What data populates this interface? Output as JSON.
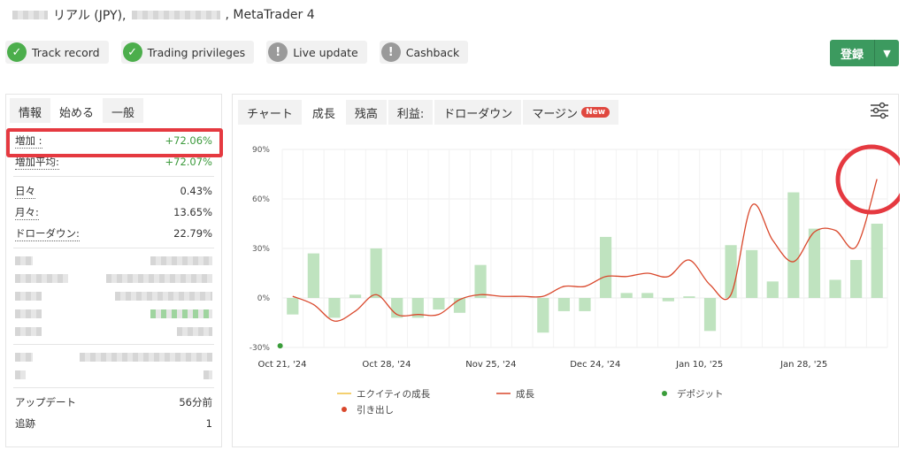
{
  "header": {
    "account_type": "リアル (JPY),",
    "platform": ", MetaTrader 4"
  },
  "badges": [
    {
      "label": "Track record",
      "status": "ok"
    },
    {
      "label": "Trading privileges",
      "status": "ok"
    },
    {
      "label": "Live update",
      "status": "warn"
    },
    {
      "label": "Cashback",
      "status": "warn"
    }
  ],
  "register": {
    "label": "登録",
    "dropdown_icon": "chevron-down-icon"
  },
  "left_tabs": [
    "情報",
    "始める",
    "一般"
  ],
  "stats_top": [
    {
      "label": "増加 :",
      "value": "+72.06%"
    },
    {
      "label": "増加平均:",
      "value": "+72.07%"
    }
  ],
  "stats_mid": [
    {
      "label": "日々",
      "value": "0.43%"
    },
    {
      "label": "月々:",
      "value": "13.65%"
    },
    {
      "label": "ドローダウン:",
      "value": "22.79%"
    }
  ],
  "stats_bottom": [
    {
      "label": "アップデート",
      "value": "56分前"
    },
    {
      "label": "追跡",
      "value": "1"
    }
  ],
  "chart_tabs": [
    {
      "label": "チャート",
      "active": false
    },
    {
      "label": "成長",
      "active": true
    },
    {
      "label": "残高",
      "active": false
    },
    {
      "label": "利益:",
      "active": false
    },
    {
      "label": "ドローダウン",
      "active": false
    },
    {
      "label": "マージン",
      "active": false,
      "badge": "New"
    }
  ],
  "chart_data": {
    "type": "bar",
    "y_ticks": [
      "90%",
      "60%",
      "30%",
      "0%",
      "-30%"
    ],
    "ylim": [
      -30,
      90
    ],
    "x_tick_labels": [
      "Oct 21, '24",
      "Oct 28, '24",
      "Nov 25, '24",
      "Dec 24, '24",
      "Jan 10, '25",
      "Jan 28, '25"
    ],
    "x_tick_index": [
      0,
      5,
      10,
      15,
      20,
      25
    ],
    "bars": [
      -10,
      27,
      -12,
      2,
      30,
      -12,
      -12,
      -7,
      -9,
      20,
      0,
      0,
      -21,
      -8,
      -8,
      37,
      3,
      3,
      -2,
      1,
      -20,
      32,
      29,
      10,
      64,
      42,
      11,
      23,
      45
    ],
    "growth_line": [
      1,
      -4,
      -14,
      -8,
      2,
      -10,
      -10,
      -10,
      -1,
      2,
      1,
      1,
      1,
      7,
      7,
      13,
      13,
      15,
      13,
      23,
      8,
      2,
      56,
      35,
      22,
      40,
      41,
      31,
      72
    ],
    "deposit_marker": {
      "index": 0,
      "value": -29
    },
    "legend": [
      {
        "label": "エクイティの成長",
        "type": "line",
        "color": "#f0c040"
      },
      {
        "label": "成長",
        "type": "line",
        "color": "#d9472b"
      },
      {
        "label": "デポジット",
        "type": "dot",
        "color": "#3a9d3a"
      },
      {
        "label": "引き出し",
        "type": "dot",
        "color": "#d9472b"
      }
    ],
    "bar_color": "#bfe3bf",
    "line_color": "#d9472b",
    "annotation_color": "#e53940"
  }
}
